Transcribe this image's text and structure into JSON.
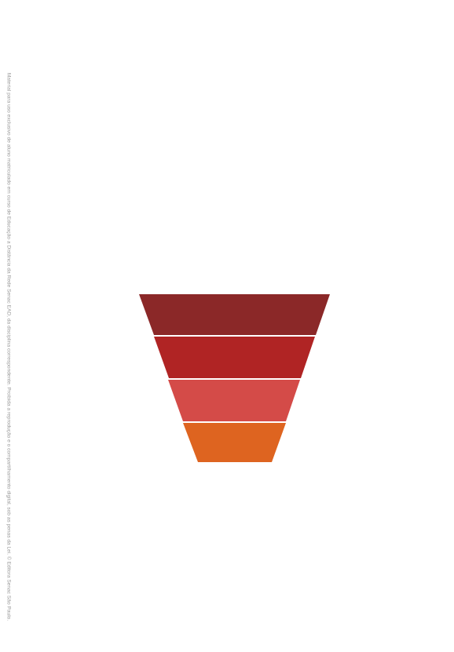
{
  "side_notice": {
    "text": "Material para uso exclusivo de aluno matriculado em curso de Educação a Distância da Rede Senac EAD, da disciplina correspondente. Proibida a reprodução e o compartilhamento digital, sob as penas da Lei. © Editora Senac São Paulo."
  },
  "funnel": {
    "stages": [
      {
        "id": "stage-1",
        "color": "#8b2828"
      },
      {
        "id": "stage-2",
        "color": "#b02424"
      },
      {
        "id": "stage-3",
        "color": "#d44b48"
      },
      {
        "id": "stage-4",
        "color": "#de6420"
      }
    ],
    "separator_color": "#ffffff"
  }
}
